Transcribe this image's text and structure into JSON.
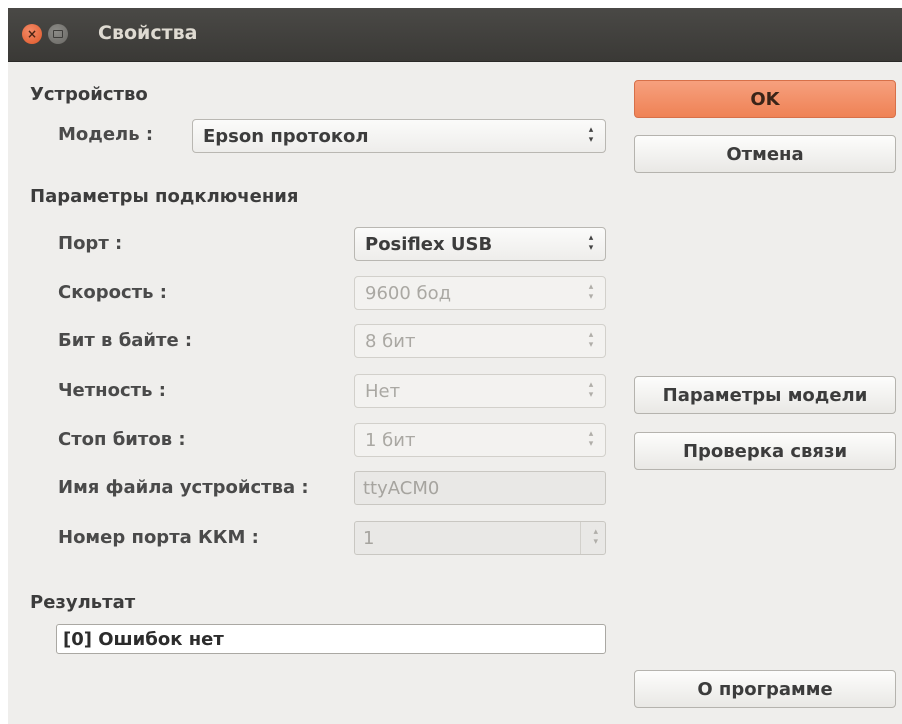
{
  "window": {
    "title": "Свойства"
  },
  "device": {
    "section_label": "Устройство",
    "model_label": "Модель :",
    "model_value": "Epson протокол"
  },
  "connection": {
    "section_label": "Параметры подключения",
    "port": {
      "label": "Порт :",
      "value": "Posiflex USB"
    },
    "speed": {
      "label": "Скорость :",
      "value": "9600 бод"
    },
    "bits": {
      "label": "Бит в байте :",
      "value": "8 бит"
    },
    "parity": {
      "label": "Четность :",
      "value": "Нет"
    },
    "stop_bits": {
      "label": "Стоп битов :",
      "value": "1 бит"
    },
    "device_file": {
      "label": "Имя файла устройства :",
      "value": "ttyACM0"
    },
    "kkm_port": {
      "label": "Номер порта ККМ :",
      "value": "1"
    }
  },
  "result": {
    "section_label": "Результат",
    "value": "[0] Ошибок нет"
  },
  "buttons": {
    "ok": "OK",
    "cancel": "Отмена",
    "model_params": "Параметры модели",
    "check_connection": "Проверка связи",
    "about": "О программе"
  },
  "colors": {
    "titlebar": "#3f3e3b",
    "close_button": "#e95420",
    "ok_button": "#f08b60",
    "window_bg": "#efeeec"
  }
}
